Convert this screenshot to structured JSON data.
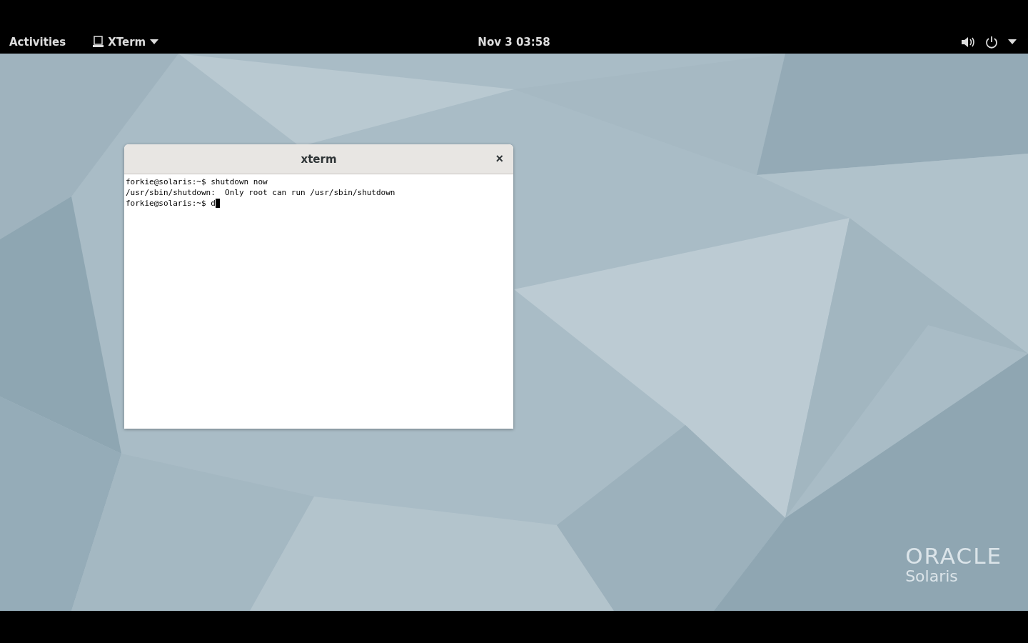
{
  "top_bar": {
    "activities": "Activities",
    "app_menu": "XTerm",
    "clock": "Nov 3  03:58"
  },
  "window": {
    "title": "xterm",
    "close": "×",
    "lines": [
      "forkie@solaris:~$ shutdown now",
      "/usr/sbin/shutdown:  Only root can run /usr/sbin/shutdown",
      "forkie@solaris:~$ d"
    ],
    "cursor_visible": true
  },
  "branding": {
    "logo": "ORACLE",
    "product": "Solaris"
  }
}
